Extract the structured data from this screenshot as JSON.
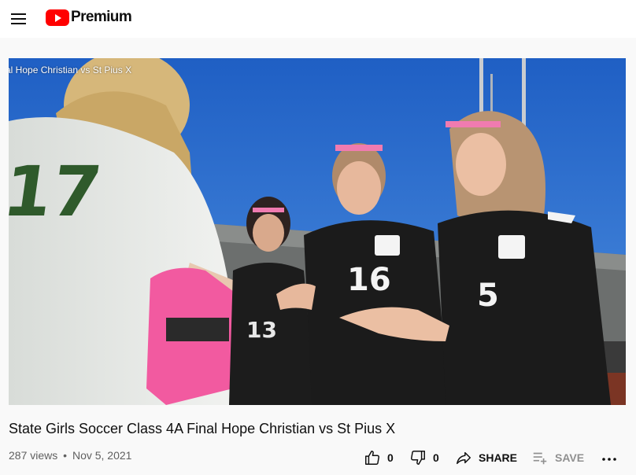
{
  "header": {
    "logo_text": "Premium",
    "menu_icon": "hamburger-menu-icon",
    "brand_color": "#ff0000"
  },
  "player": {
    "overlay_title": "al Hope Christian vs St Pius X",
    "jersey_numbers": [
      "17",
      "16",
      "5",
      "13"
    ]
  },
  "video": {
    "title": "State Girls Soccer Class 4A Final Hope Christian vs St Pius X",
    "views": "287 views",
    "separator": "•",
    "date": "Nov 5, 2021"
  },
  "actions": {
    "like_count": "0",
    "dislike_count": "0",
    "share_label": "SHARE",
    "save_label": "SAVE",
    "like_icon": "thumbs-up-icon",
    "dislike_icon": "thumbs-down-icon",
    "share_icon": "share-arrow-icon",
    "save_icon": "playlist-add-icon",
    "more_icon": "more-horizontal-icon"
  }
}
